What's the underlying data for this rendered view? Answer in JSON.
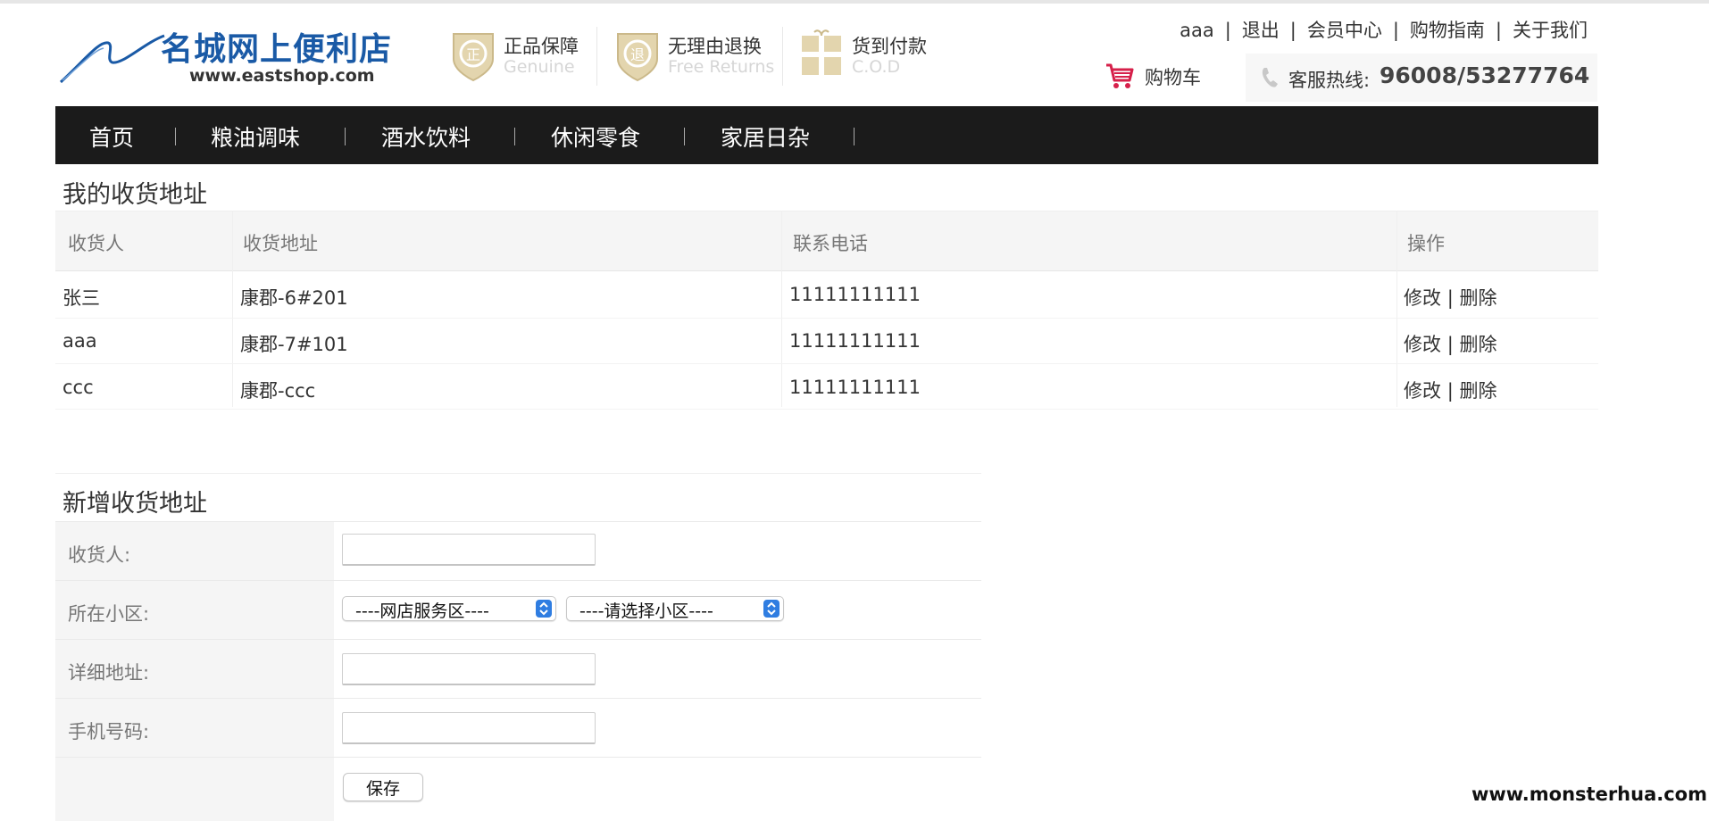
{
  "header": {
    "logo_title": "名城网上便利店",
    "logo_url": "www.eastshop.com",
    "badges": [
      {
        "cn": "正品保障",
        "en": "Genuine",
        "icon": "shield-zheng-icon"
      },
      {
        "cn": "无理由退换",
        "en": "Free Returns",
        "icon": "shield-tui-icon"
      },
      {
        "cn": "货到付款",
        "en": "C.O.D",
        "icon": "gift-box-icon"
      }
    ],
    "top_links": {
      "user": "aaa",
      "logout": "退出",
      "member_center": "会员中心",
      "shopping_guide": "购物指南",
      "about_us": "关于我们",
      "separator": "|"
    },
    "cart_label": "购物车",
    "hotline_label": "客服热线:",
    "hotline_number": "96008/53277764"
  },
  "nav": {
    "items": [
      "首页",
      "粮油调味",
      "酒水饮料",
      "休闲零食",
      "家居日杂"
    ]
  },
  "address_list": {
    "title": "我的收货地址",
    "headers": [
      "收货人",
      "收货地址",
      "联系电话",
      "操作"
    ],
    "rows": [
      {
        "name": "张三",
        "address": "康郡-6#201",
        "phone": "11111111111",
        "edit": "修改",
        "sep": "|",
        "delete": "删除"
      },
      {
        "name": "aaa",
        "address": "康郡-7#101",
        "phone": "11111111111",
        "edit": "修改",
        "sep": "|",
        "delete": "删除"
      },
      {
        "name": "ccc",
        "address": "康郡-ccc",
        "phone": "11111111111",
        "edit": "修改",
        "sep": "|",
        "delete": "删除"
      }
    ]
  },
  "new_address": {
    "title": "新增收货地址",
    "labels": {
      "receiver": "收货人:",
      "community": "所在小区:",
      "detail": "详细地址:",
      "mobile": "手机号码:"
    },
    "receiver_value": "",
    "detail_value": "",
    "mobile_value": "",
    "service_area_select": "----网店服务区----",
    "community_select": "----请选择小区----",
    "save_label": "保存"
  },
  "watermark": "www.monsterhua.com",
  "colors": {
    "nav_bg": "#1b1b1b",
    "logo_blue": "#1a5aa6",
    "cart_red": "#d6204a",
    "select_arrow_blue": "#2f7de1",
    "badge_gold": "#d9c79a"
  }
}
